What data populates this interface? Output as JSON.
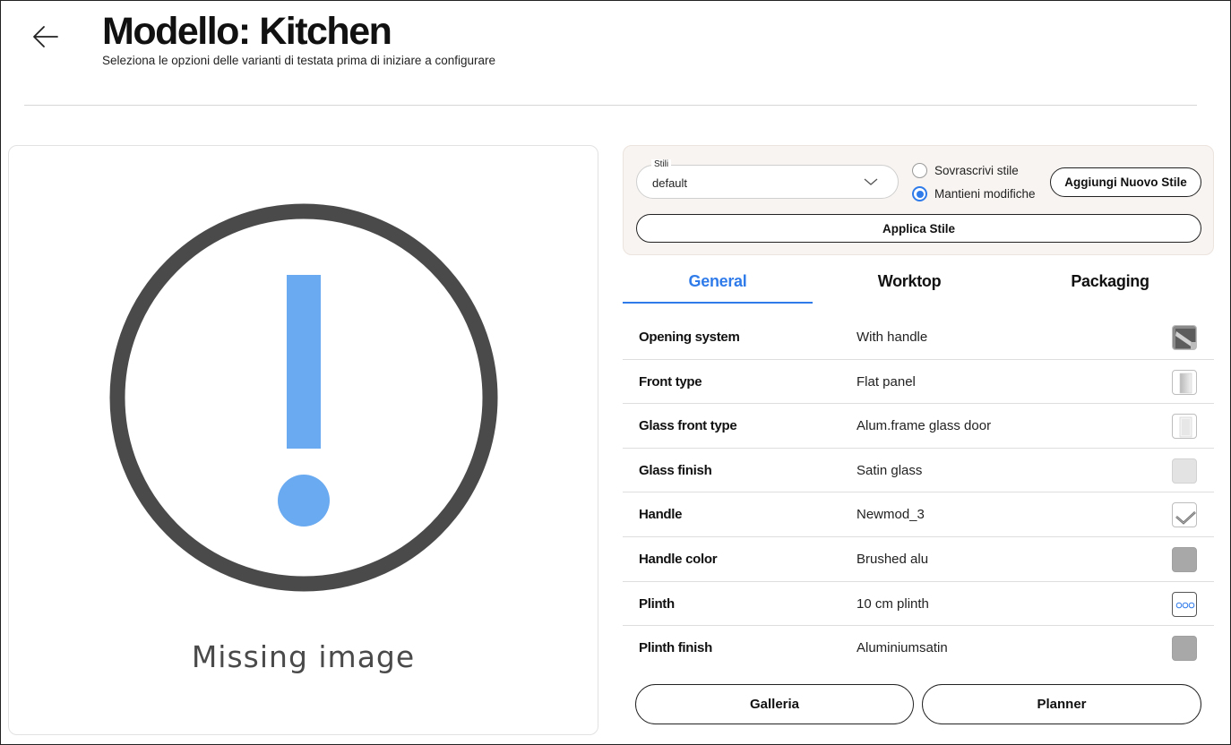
{
  "header": {
    "back_icon": "arrow-left-icon",
    "title": "Modello: Kitchen",
    "subtitle": "Seleziona le opzioni delle varianti di testata prima di iniziare a configurare"
  },
  "image_panel": {
    "icon": "warning-exclamation-icon",
    "caption": "Missing image",
    "colors": {
      "ring": "#4a4a4a",
      "mark": "#6aaaf0"
    }
  },
  "styles": {
    "select_legend": "Stili",
    "select_value": "default",
    "radio_overwrite": "Sovrascrivi stile",
    "radio_keep": "Mantieni modifiche",
    "selected_radio": "Mantieni modifiche",
    "add_button": "Aggiungi Nuovo Stile",
    "apply_button": "Applica Stile"
  },
  "tabs": [
    {
      "label": "General",
      "active": true
    },
    {
      "label": "Worktop",
      "active": false
    },
    {
      "label": "Packaging",
      "active": false
    }
  ],
  "options": [
    {
      "label": "Opening system",
      "value": "With handle",
      "thumb": "handle-photo"
    },
    {
      "label": "Front type",
      "value": "Flat panel",
      "thumb": "flat-panel"
    },
    {
      "label": "Glass front type",
      "value": "Alum.frame glass door",
      "thumb": "glass-door"
    },
    {
      "label": "Glass finish",
      "value": "Satin glass",
      "thumb": "satin-swatch"
    },
    {
      "label": "Handle",
      "value": "Newmod_3",
      "thumb": "handle-shape"
    },
    {
      "label": "Handle color",
      "value": "Brushed alu",
      "thumb": "alu-swatch"
    },
    {
      "label": "Plinth",
      "value": "10 cm plinth",
      "thumb": "plinth-dots"
    },
    {
      "label": "Plinth finish",
      "value": "Aluminiumsatin",
      "thumb": "alu-swatch"
    }
  ],
  "footer": {
    "gallery_button": "Galleria",
    "planner_button": "Planner"
  },
  "colors": {
    "accent": "#2f7bea",
    "panel_bg": "#f8f4f1"
  }
}
